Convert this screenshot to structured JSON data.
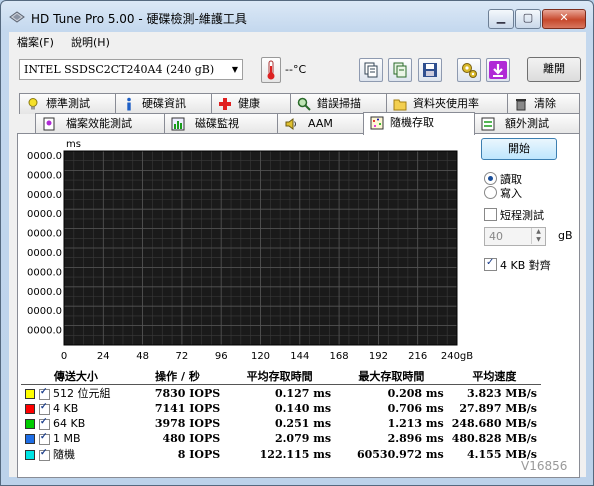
{
  "window": {
    "title": "HD Tune Pro  5.00 - 硬碟檢測-維護工具"
  },
  "menu": [
    "檔案(F)",
    "說明(H)"
  ],
  "toolbar": {
    "drive": "INTEL SSDSC2CT240A4 (240 gB)",
    "temperature": "--°C",
    "exit_label": "離開"
  },
  "tabs_row1": [
    {
      "label": "標準測試",
      "icon": "bulb-icon"
    },
    {
      "label": "硬碟資訊",
      "icon": "info-icon"
    },
    {
      "label": "健康",
      "icon": "health-cross-icon"
    },
    {
      "label": "錯誤掃描",
      "icon": "magnifier-icon"
    },
    {
      "label": "資料夾使用率",
      "icon": "folder-icon"
    },
    {
      "label": "清除",
      "icon": "trash-icon"
    }
  ],
  "tabs_row2": [
    {
      "label": "檔案效能測試",
      "icon": "file-benchmark-icon"
    },
    {
      "label": "磁碟監視",
      "icon": "disk-monitor-icon"
    },
    {
      "label": "AAM",
      "icon": "speaker-icon"
    },
    {
      "label": "隨機存取",
      "icon": "random-access-icon",
      "active": true
    },
    {
      "label": "額外測試",
      "icon": "extra-tests-icon"
    }
  ],
  "chart_data": {
    "type": "scatter",
    "ylabel": "ms",
    "y_tick_labels": [
      "0000.0",
      "0000.0",
      "0000.0",
      "0000.0",
      "0000.0",
      "0000.0",
      "0000.0",
      "0000.0",
      "0000.0",
      "0000.0"
    ],
    "x_ticks": [
      "0",
      "24",
      "48",
      "72",
      "96",
      "120",
      "144",
      "168",
      "192",
      "216",
      "240gB"
    ],
    "xlim": [
      0,
      240
    ],
    "grid": true,
    "series": []
  },
  "controls": {
    "start_label": "開始",
    "read_label": "讀取",
    "write_label": "寫入",
    "mode": "read",
    "short_test_label": "短程測試",
    "short_test_checked": false,
    "short_test_size": "40",
    "short_test_unit": "gB",
    "align_label": "4 KB 對齊",
    "align_checked": true
  },
  "results": {
    "headers": [
      "傳送大小",
      "操作 / 秒",
      "平均存取時間",
      "最大存取時間",
      "平均速度"
    ],
    "rows": [
      {
        "color": "#ffff00",
        "label": "512 位元組",
        "ops": "7830 IOPS",
        "avg": "0.127 ms",
        "max": "0.208 ms",
        "speed": "3.823 MB/s"
      },
      {
        "color": "#ff0000",
        "label": "4 KB",
        "ops": "7141 IOPS",
        "avg": "0.140 ms",
        "max": "0.706 ms",
        "speed": "27.897 MB/s"
      },
      {
        "color": "#00cc00",
        "label": "64 KB",
        "ops": "3978 IOPS",
        "avg": "0.251 ms",
        "max": "1.213 ms",
        "speed": "248.680 MB/s"
      },
      {
        "color": "#1e6ee6",
        "label": "1 MB",
        "ops": "480 IOPS",
        "avg": "2.079 ms",
        "max": "2.896 ms",
        "speed": "480.828 MB/s"
      },
      {
        "color": "#00e5e5",
        "label": "隨機",
        "ops": "8 IOPS",
        "avg": "122.115 ms",
        "max": "60530.972 ms",
        "speed": "4.155 MB/s"
      }
    ]
  },
  "watermark": "V16856"
}
